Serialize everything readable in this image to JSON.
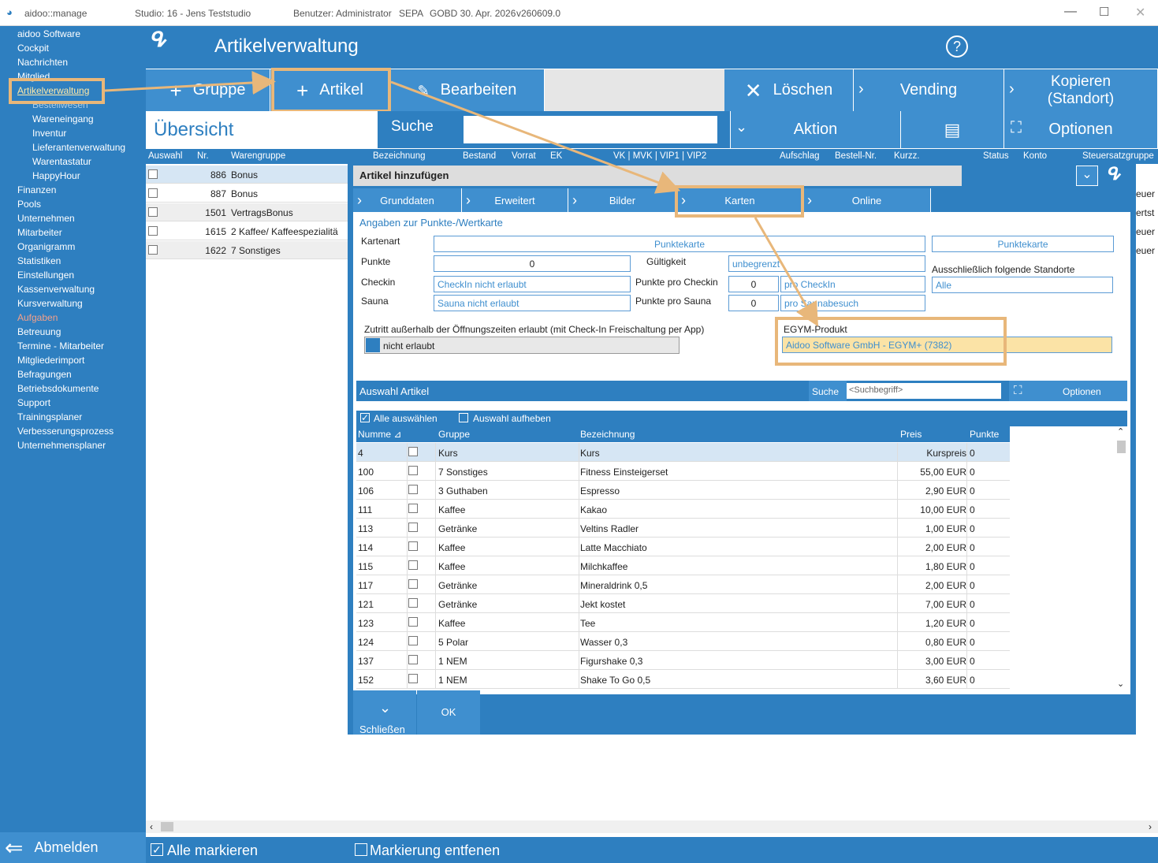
{
  "titlebar": {
    "app": "aidoo::manage",
    "studio": "Studio: 16 - Jens Teststudio",
    "user": "Benutzer: Administrator",
    "sepa": "SEPA",
    "gobd": "GOBD 30. Apr. 2026",
    "version": "v260609.0"
  },
  "sidebar": {
    "items": [
      "aidoo Software",
      "Cockpit",
      "Nachrichten",
      "Mitglied",
      "Artikelverwaltung",
      "Bestellwesen",
      "Wareneingang",
      "Inventur",
      "Lieferantenverwaltung",
      "Warentastatur",
      "HappyHour",
      "Finanzen",
      "Pools",
      "Unternehmen",
      "Mitarbeiter",
      "Organigramm",
      "Statistiken",
      "Einstellungen",
      "Kassenverwaltung",
      "Kursverwaltung",
      "Aufgaben",
      "Betreuung",
      "Termine - Mitarbeiter",
      "Mitgliederimport",
      "Befragungen",
      "Betriebsdokumente",
      "Support",
      "Trainingsplaner",
      "Verbesserungsprozess",
      "Unternehmensplaner"
    ],
    "logout": "Abmelden"
  },
  "header": {
    "title": "Artikelverwaltung",
    "help": "?"
  },
  "toolbar": {
    "gruppe": "Gruppe",
    "artikel": "Artikel",
    "bearbeiten": "Bearbeiten",
    "loeschen": "Löschen",
    "vending": "Vending",
    "kopieren": "Kopieren",
    "kopieren2": "(Standort)",
    "aktion": "Aktion",
    "optionen": "Optionen"
  },
  "overview": {
    "title": "Übersicht",
    "search": "Suche",
    "columns": [
      "Auswahl",
      "Nr.",
      "Warengruppe",
      "Bezeichnung",
      "Bestand",
      "Vorrat",
      "EK",
      "VK | MVK | VIP1 | VIP2",
      "Aufschlag",
      "Bestell-Nr.",
      "Kurzz.",
      "Status",
      "Konto",
      "Steuersatzgruppe"
    ],
    "rows": [
      {
        "nr": "886",
        "grp": "Bonus",
        "tail": "euer"
      },
      {
        "nr": "887",
        "grp": "Bonus",
        "tail": "euer"
      },
      {
        "nr": "1501",
        "grp": "VertragsBonus",
        "tail": "ertst"
      },
      {
        "nr": "1615",
        "grp": "2 Kaffee/ Kaffeespezialitä",
        "tail": "euer"
      },
      {
        "nr": "1622",
        "grp": "7 Sonstiges",
        "tail": "euer"
      }
    ]
  },
  "footer": {
    "mark_all": "Alle markieren",
    "unmark": "Markierung entfenen"
  },
  "dialog": {
    "title": "Artikel hinzufügen",
    "tabs": [
      "Grunddaten",
      "Erweitert",
      "Bilder",
      "Karten",
      "Online"
    ],
    "section": "Angaben zur Punkte-/Wertkarte",
    "kartenart_lbl": "Kartenart",
    "kartenart": "Punktekarte",
    "kartenart2": "Punktekarte",
    "punkte_lbl": "Punkte",
    "punkte": "0",
    "gueltig_lbl": "Gültigkeit",
    "gueltig": "unbegrenzt",
    "checkin_lbl": "Checkin",
    "checkin": "CheckIn nicht erlaubt",
    "ppc_lbl": "Punkte pro Checkin",
    "ppc": "0",
    "ppc_unit": "pro CheckIn",
    "sauna_lbl": "Sauna",
    "sauna": "Sauna nicht erlaubt",
    "pps_lbl": "Punkte pro Sauna",
    "pps": "0",
    "pps_unit": "pro Saunabesuch",
    "standorte_lbl": "Ausschließlich folgende Standorte",
    "standorte": "Alle",
    "zutritt_lbl": "Zutritt außerhalb der Öffnungszeiten erlaubt (mit Check-In Freischaltung per App)",
    "zutritt": "nicht erlaubt",
    "egym_lbl": "EGYM-Produkt",
    "egym": "Aidoo Software GmbH - EGYM+ (7382)",
    "auswahl": "Auswahl Artikel",
    "suche": "Suche",
    "suche_ph": "<Suchbegriff>",
    "optionen": "Optionen",
    "select_all": "Alle auswählen",
    "deselect": "Auswahl aufheben",
    "cols": {
      "nr": "Numme ⊿",
      "grp": "Gruppe",
      "bez": "Bezeichnung",
      "preis": "Preis",
      "punkte": "Punkte"
    },
    "rows": [
      {
        "nr": "4",
        "grp": "Kurs",
        "bez": "Kurs",
        "preis": "Kurspreis",
        "p": "0"
      },
      {
        "nr": "100",
        "grp": "7 Sonstiges",
        "bez": "Fitness Einsteigerset",
        "preis": "55,00 EUR",
        "p": "0"
      },
      {
        "nr": "106",
        "grp": "3 Guthaben",
        "bez": "Espresso",
        "preis": "2,90 EUR",
        "p": "0"
      },
      {
        "nr": "111",
        "grp": "Kaffee",
        "bez": "Kakao",
        "preis": "10,00 EUR",
        "p": "0"
      },
      {
        "nr": "113",
        "grp": "Getränke",
        "bez": "Veltins Radler",
        "preis": "1,00 EUR",
        "p": "0"
      },
      {
        "nr": "114",
        "grp": "Kaffee",
        "bez": "Latte Macchiato",
        "preis": "2,00 EUR",
        "p": "0"
      },
      {
        "nr": "115",
        "grp": "Kaffee",
        "bez": "Milchkaffee",
        "preis": "1,80 EUR",
        "p": "0"
      },
      {
        "nr": "117",
        "grp": "Getränke",
        "bez": "Mineraldrink 0,5",
        "preis": "2,00 EUR",
        "p": "0"
      },
      {
        "nr": "121",
        "grp": "Getränke",
        "bez": "Jekt kostet",
        "preis": "7,00 EUR",
        "p": "0"
      },
      {
        "nr": "123",
        "grp": "Kaffee",
        "bez": "Tee",
        "preis": "1,20 EUR",
        "p": "0"
      },
      {
        "nr": "124",
        "grp": "5 Polar",
        "bez": "Wasser 0,3",
        "preis": "0,80 EUR",
        "p": "0"
      },
      {
        "nr": "137",
        "grp": "1 NEM",
        "bez": "Figurshake 0,3",
        "preis": "3,00 EUR",
        "p": "0"
      },
      {
        "nr": "152",
        "grp": "1 NEM",
        "bez": "Shake To Go 0,5",
        "preis": "3,60 EUR",
        "p": "0"
      }
    ],
    "close": "Schließen",
    "ok": "OK"
  },
  "colors": {
    "accent": "#2e7fc0",
    "highlight": "#e8b77a",
    "egym_bg": "#fbe3a6"
  }
}
